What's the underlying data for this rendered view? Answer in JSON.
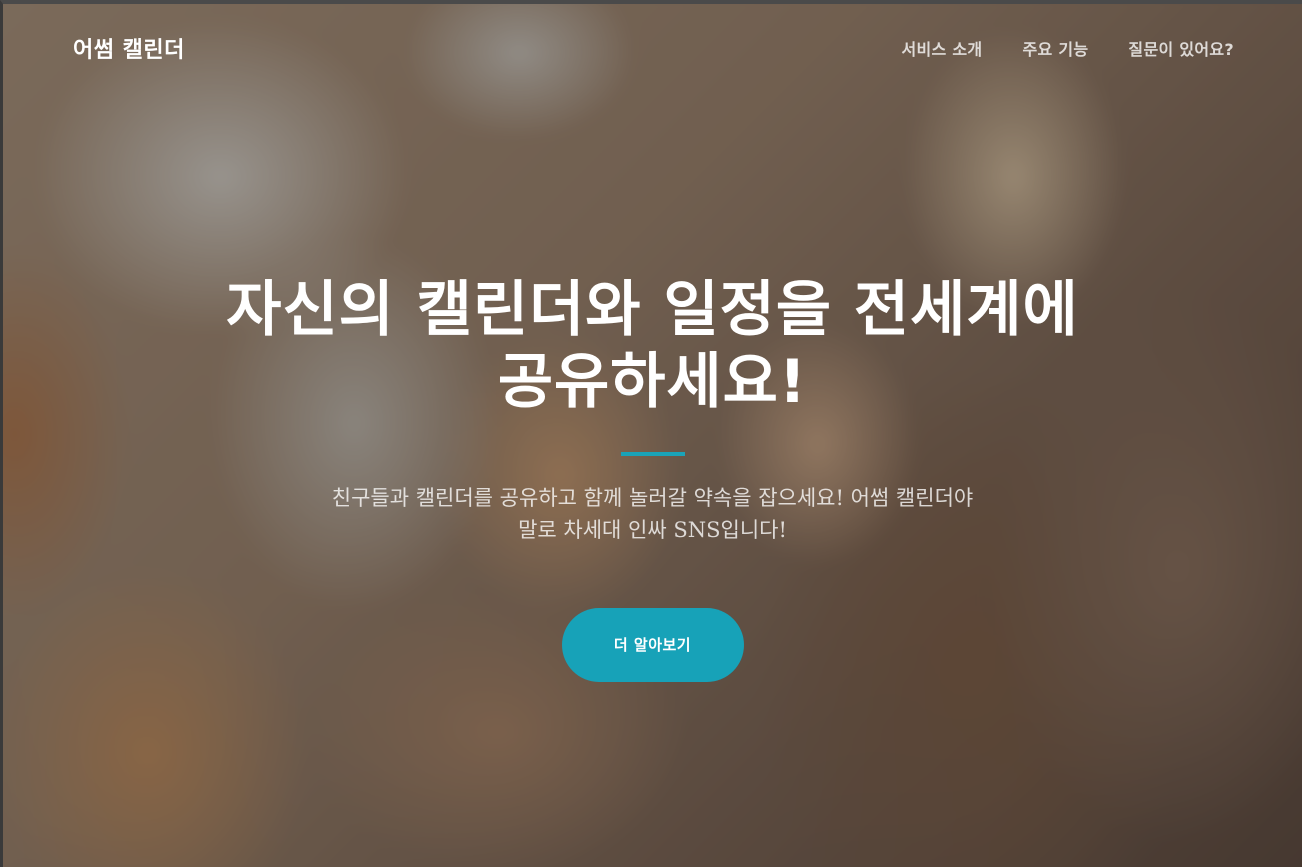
{
  "navbar": {
    "brand": "어썸 캘린더",
    "links": [
      {
        "label": "서비스 소개"
      },
      {
        "label": "주요 기능"
      },
      {
        "label": "질문이 있어요?"
      }
    ]
  },
  "hero": {
    "headline_line1": "자신의 캘린더와 일정을 전세계에",
    "headline_line2": "공유하세요!",
    "subtext_line1": "친구들과 캘린더를 공유하고 함께 놀러갈 약속을 잡으세요! 어썸 캘린더야",
    "subtext_line2": "말로 차세대 인싸 SNS입니다!",
    "cta_label": "더 알아보기"
  },
  "colors": {
    "accent": "#17a2b8",
    "text_primary": "#ffffff"
  }
}
